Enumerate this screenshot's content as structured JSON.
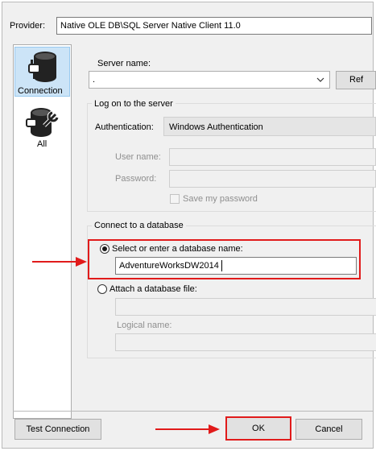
{
  "header": {
    "provider_label": "Provider:",
    "provider_value": "Native OLE DB\\SQL Server Native Client 11.0"
  },
  "sidebar": {
    "items": [
      {
        "label": "Connection",
        "icon": "connection-icon"
      },
      {
        "label": "All",
        "icon": "all-properties-icon"
      }
    ]
  },
  "server": {
    "label": "Server name:",
    "value": ".",
    "refresh_label": "Ref"
  },
  "logon": {
    "legend": "Log on to the server",
    "auth_label": "Authentication:",
    "auth_value": "Windows Authentication",
    "username_label": "User name:",
    "password_label": "Password:",
    "save_password_label": "Save my password"
  },
  "database": {
    "legend": "Connect to a database",
    "select_option_label": "Select or enter a database name:",
    "database_value": "AdventureWorksDW2014",
    "attach_option_label": "Attach a database file:",
    "logical_name_label": "Logical name:"
  },
  "footer": {
    "test_label": "Test Connection",
    "ok_label": "OK",
    "cancel_label": "Cancel"
  },
  "colors": {
    "highlight": "#e11b1b",
    "sidebar_selected": "#cce4f7"
  }
}
